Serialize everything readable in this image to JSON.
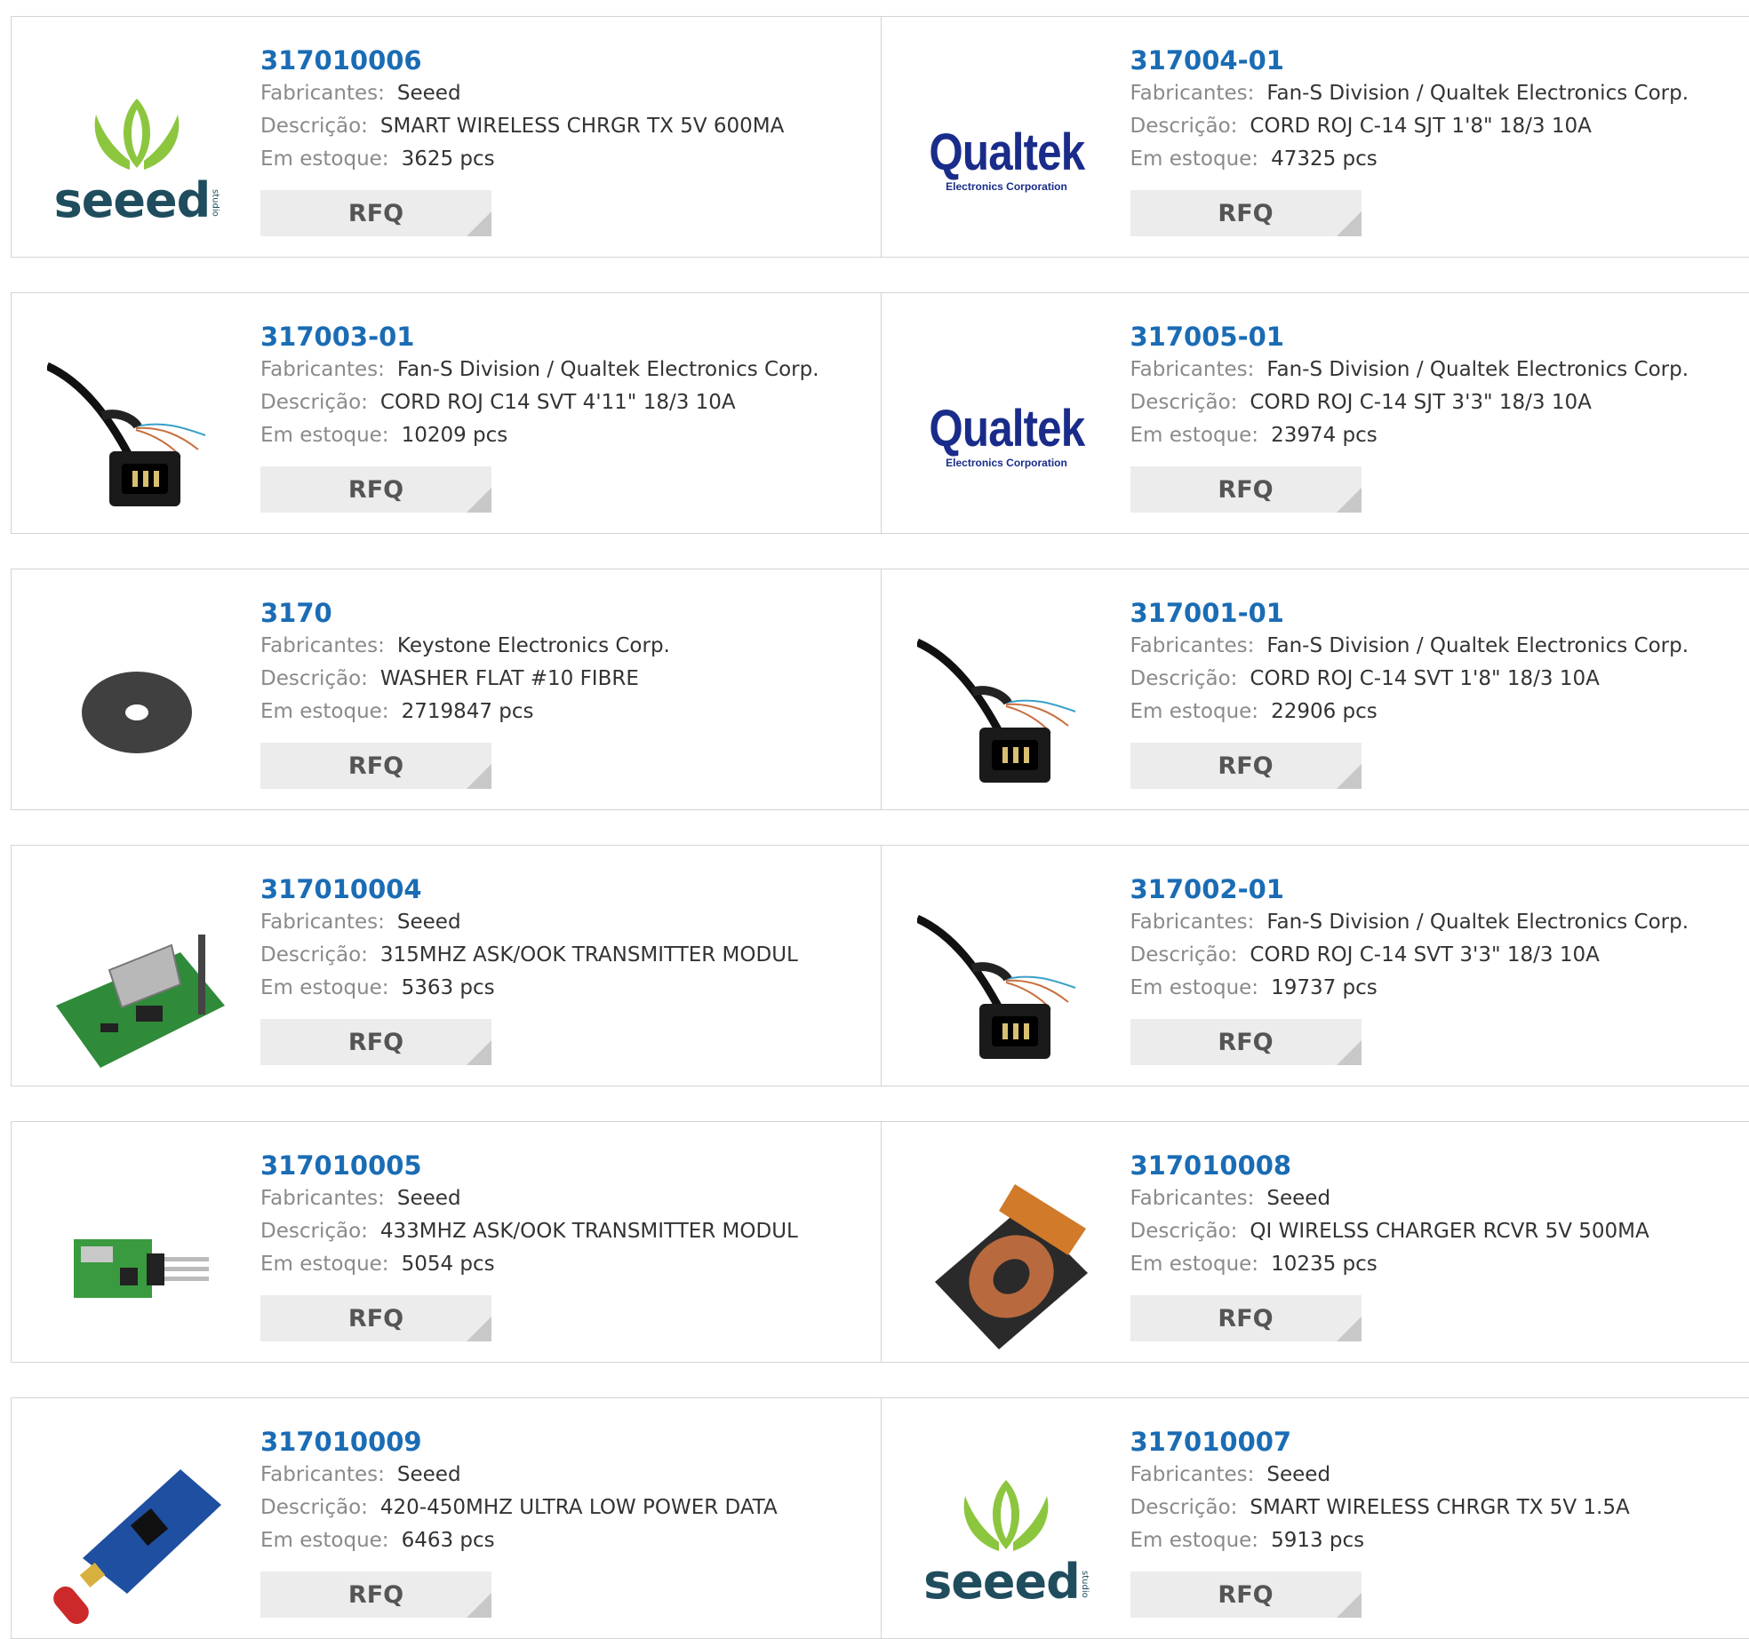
{
  "labels": {
    "manufacturer": "Fabricantes:",
    "description": "Descrição:",
    "stock": "Em estoque:",
    "rfq": "RFQ"
  },
  "logos": {
    "seeed": "seeed",
    "seeed_studio": "studio",
    "qualtek": "Qualtek",
    "qualtek_sub": "Electronics Corporation"
  },
  "products": [
    {
      "part": "317010006",
      "manufacturer": "Seeed",
      "description": "SMART WIRELESS CHRGR TX 5V 600MA",
      "stock": "3625 pcs",
      "image": "seeed-logo"
    },
    {
      "part": "317004-01",
      "manufacturer": "Fan-S Division / Qualtek Electronics Corp.",
      "description": "CORD ROJ C-14 SJT 1'8\" 18/3 10A",
      "stock": "47325 pcs",
      "image": "qualtek-logo"
    },
    {
      "part": "317003-01",
      "manufacturer": "Fan-S Division / Qualtek Electronics Corp.",
      "description": "CORD ROJ C14 SVT 4'11\" 18/3 10A",
      "stock": "10209 pcs",
      "image": "power-cord"
    },
    {
      "part": "317005-01",
      "manufacturer": "Fan-S Division / Qualtek Electronics Corp.",
      "description": "CORD ROJ C-14 SJT 3'3\" 18/3 10A",
      "stock": "23974 pcs",
      "image": "qualtek-logo"
    },
    {
      "part": "3170",
      "manufacturer": "Keystone Electronics Corp.",
      "description": "WASHER FLAT #10 FIBRE",
      "stock": "2719847 pcs",
      "image": "washer"
    },
    {
      "part": "317001-01",
      "manufacturer": "Fan-S Division / Qualtek Electronics Corp.",
      "description": "CORD ROJ C-14 SVT 1'8\" 18/3 10A",
      "stock": "22906 pcs",
      "image": "power-cord"
    },
    {
      "part": "317010004",
      "manufacturer": "Seeed",
      "description": "315MHZ ASK/OOK TRANSMITTER MODUL",
      "stock": "5363 pcs",
      "image": "rf-module-large"
    },
    {
      "part": "317002-01",
      "manufacturer": "Fan-S Division / Qualtek Electronics Corp.",
      "description": "CORD ROJ C-14 SVT 3'3\" 18/3 10A",
      "stock": "19737 pcs",
      "image": "power-cord"
    },
    {
      "part": "317010005",
      "manufacturer": "Seeed",
      "description": "433MHZ ASK/OOK TRANSMITTER MODUL",
      "stock": "5054 pcs",
      "image": "rf-module-small"
    },
    {
      "part": "317010008",
      "manufacturer": "Seeed",
      "description": "QI WIRELSS CHARGER RCVR 5V 500MA",
      "stock": "10235 pcs",
      "image": "qi-coil"
    },
    {
      "part": "317010009",
      "manufacturer": "Seeed",
      "description": "420-450MHZ ULTRA LOW POWER DATA",
      "stock": "6463 pcs",
      "image": "rf-board-antenna"
    },
    {
      "part": "317010007",
      "manufacturer": "Seeed",
      "description": "SMART WIRELESS CHRGR TX 5V 1.5A",
      "stock": "5913 pcs",
      "image": "seeed-logo"
    }
  ],
  "colors": {
    "link": "#1a6cb4",
    "label": "#8a8a8a",
    "value": "#333333",
    "rfq_bg": "#ececec",
    "border": "#d4d4d4"
  }
}
